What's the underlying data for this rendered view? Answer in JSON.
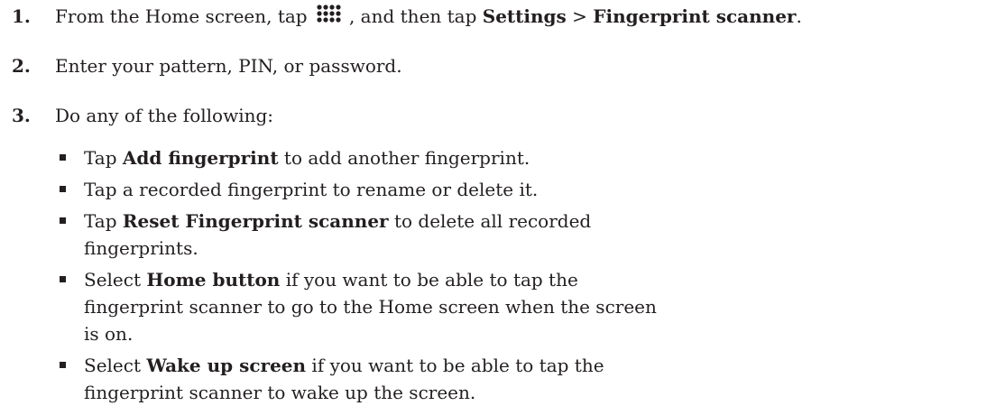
{
  "steps": [
    {
      "number": "1.",
      "text_a": "From the Home screen, tap ",
      "icon": "apps-grid-icon",
      "text_b": ", and then tap ",
      "bold_a": "Settings",
      "text_c": " > ",
      "bold_b": "Fingerprint scanner",
      "text_d": "."
    },
    {
      "number": "2.",
      "text": "Enter your pattern, PIN, or password."
    },
    {
      "number": "3.",
      "text": "Do any of the following:",
      "subitems": [
        {
          "pre": "Tap ",
          "bold": "Add fingerprint",
          "post": " to add another fingerprint."
        },
        {
          "pre": "Tap a recorded fingerprint to rename or delete it.",
          "bold": "",
          "post": ""
        },
        {
          "pre": "Tap ",
          "bold": "Reset Fingerprint scanner",
          "post": " to delete all recorded fingerprints."
        },
        {
          "pre": "Select ",
          "bold": "Home button",
          "post": " if you want to be able to tap the fingerprint scanner to go to the Home screen when the screen is on."
        },
        {
          "pre": "Select ",
          "bold": "Wake up screen",
          "post": " if you want to be able to tap the fingerprint scanner to wake up the screen."
        }
      ]
    }
  ]
}
